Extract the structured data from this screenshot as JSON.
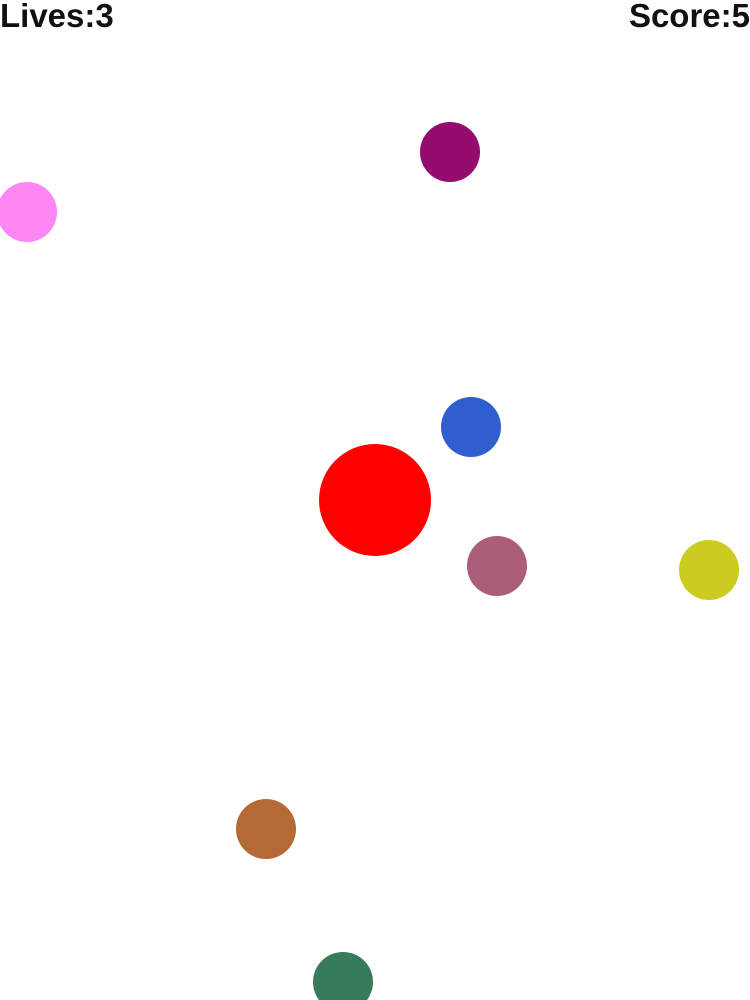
{
  "hud": {
    "lives_label": "Lives:3",
    "score_label": "Score:5",
    "lives": 3,
    "score": 5
  },
  "player": {
    "color": "#ff0000"
  },
  "balls": [
    {
      "color": "#940c6e"
    },
    {
      "color": "#ff86f5"
    },
    {
      "color": "#305ecf"
    },
    {
      "color": "#ac5d7b"
    },
    {
      "color": "#cbcb20"
    },
    {
      "color": "#b36a34"
    },
    {
      "color": "#377b5b"
    }
  ]
}
